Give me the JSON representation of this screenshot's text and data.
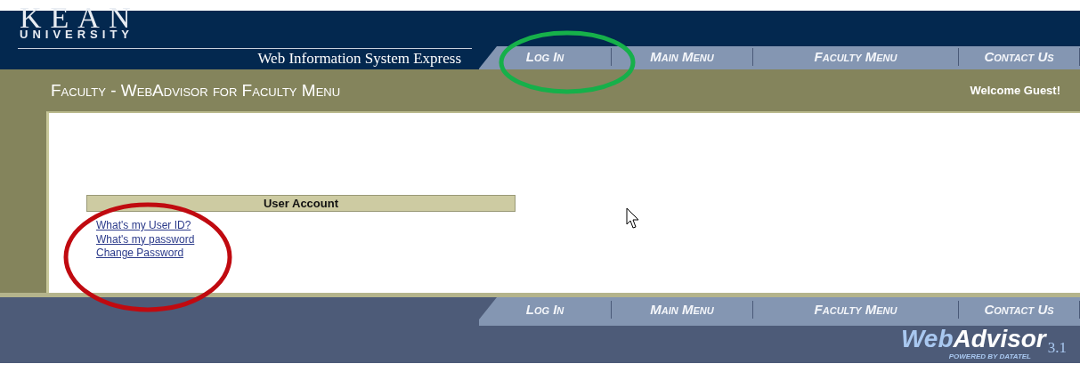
{
  "header": {
    "logo_word": "KEAN",
    "logo_sub": "UNIVERSITY",
    "system_name": "Web Information System Express"
  },
  "top_nav": [
    {
      "label": "Log In"
    },
    {
      "label": "Main Menu"
    },
    {
      "label": "Faculty Menu"
    },
    {
      "label": "Contact Us"
    }
  ],
  "title_bar": {
    "title": "Faculty - WebAdvisor for Faculty Menu",
    "welcome": "Welcome Guest!"
  },
  "user_account": {
    "heading": "User Account",
    "links": [
      "What's my User ID?",
      "What's my password",
      "Change Password"
    ]
  },
  "bottom_nav": [
    {
      "label": "Log In"
    },
    {
      "label": "Main Menu"
    },
    {
      "label": "Faculty Menu"
    },
    {
      "label": "Contact Us"
    }
  ],
  "footer_logo": {
    "web": "Web",
    "advisor": "Advisor",
    "version": "3.1",
    "tagline": "POWERED BY DATATEL"
  }
}
